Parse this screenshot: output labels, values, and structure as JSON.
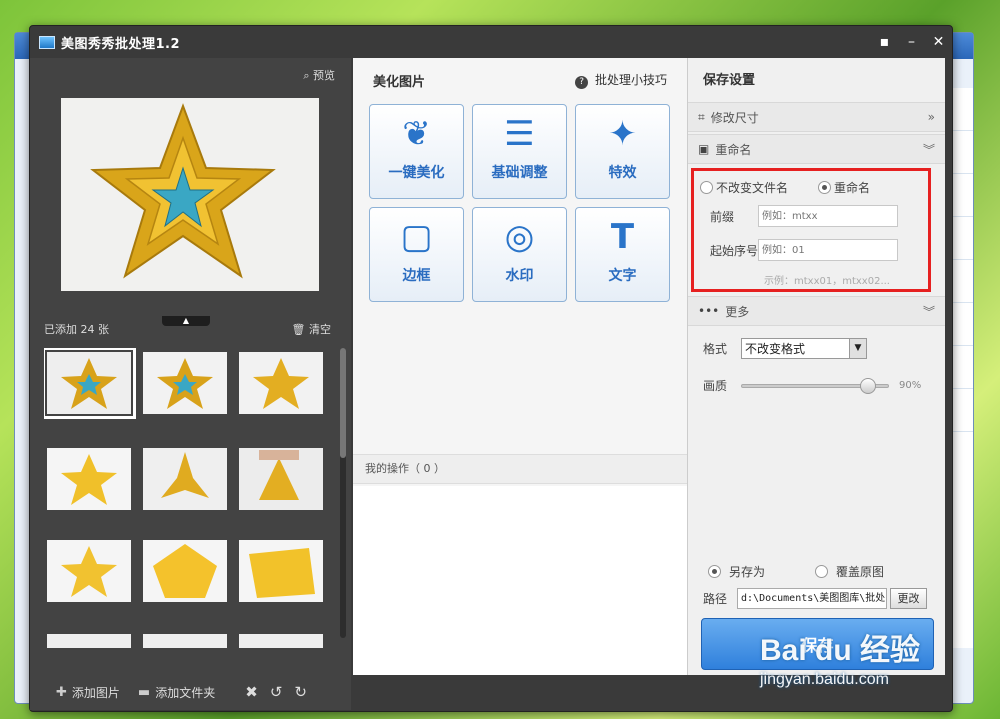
{
  "app": {
    "title": "美图秀秀批处理1.2"
  },
  "window_buttons": [
    "▪",
    "–",
    "✕"
  ],
  "left": {
    "preview_label": "预览",
    "added_count": "已添加 24 张",
    "clear_label": "清空",
    "add_image_label": "添加图片",
    "add_folder_label": "添加文件夹"
  },
  "middle": {
    "title": "美化图片",
    "tips_label": "批处理小技巧",
    "tools": [
      "一键美化",
      "基础调整",
      "特效",
      "边框",
      "水印",
      "文字"
    ],
    "ops_label": "我的操作（ 0 ）"
  },
  "right": {
    "title": "保存设置",
    "resize_label": "修改尺寸",
    "rename_label": "重命名",
    "keep_name_label": "不改变文件名",
    "rename_option_label": "重命名",
    "prefix_label": "前缀",
    "prefix_placeholder": "例如：mtxx",
    "start_label": "起始序号",
    "start_placeholder": "例如：01",
    "example_text": "示例：mtxx01，mtxx02...",
    "more_label": "更多",
    "format_label": "格式",
    "format_value": "不改变格式",
    "quality_label": "画质",
    "quality_value": "90%",
    "quality": 0.9,
    "save_as_label": "另存为",
    "overwrite_label": "覆盖原图",
    "path_label": "路径",
    "path_value": "d:\\Documents\\美图图库\\批处",
    "change_label": "更改",
    "save_label": "保存"
  },
  "watermark": {
    "logo": "Bai du 经验",
    "url": "jingyan.baidu.com"
  },
  "colors": {
    "highlight_border": "#e62020",
    "save_button": "#3a8ae0",
    "accent_blue": "#2a6cc0"
  }
}
